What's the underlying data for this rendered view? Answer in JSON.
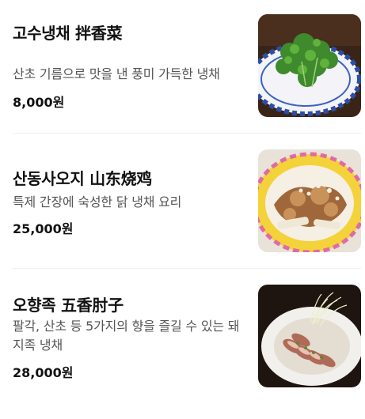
{
  "menu": {
    "items": [
      {
        "name": "고수냉채 拌香菜",
        "description": "산초 기름으로 맛을 낸 풍미 가득한 냉채",
        "price": "8,000원",
        "photo_icon": "cilantro-salad-photo"
      },
      {
        "name": "산동사오지 山东烧鸡",
        "description": "특제 간장에 숙성한 닭 냉채 요리",
        "price": "25,000원",
        "photo_icon": "chicken-dish-photo"
      },
      {
        "name": "오향족 五香肘子",
        "description": "팔각, 산초 등 5가지의 향을 즐길 수 있는 돼지족 냉채",
        "price": "28,000원",
        "photo_icon": "pork-hock-photo"
      }
    ]
  }
}
